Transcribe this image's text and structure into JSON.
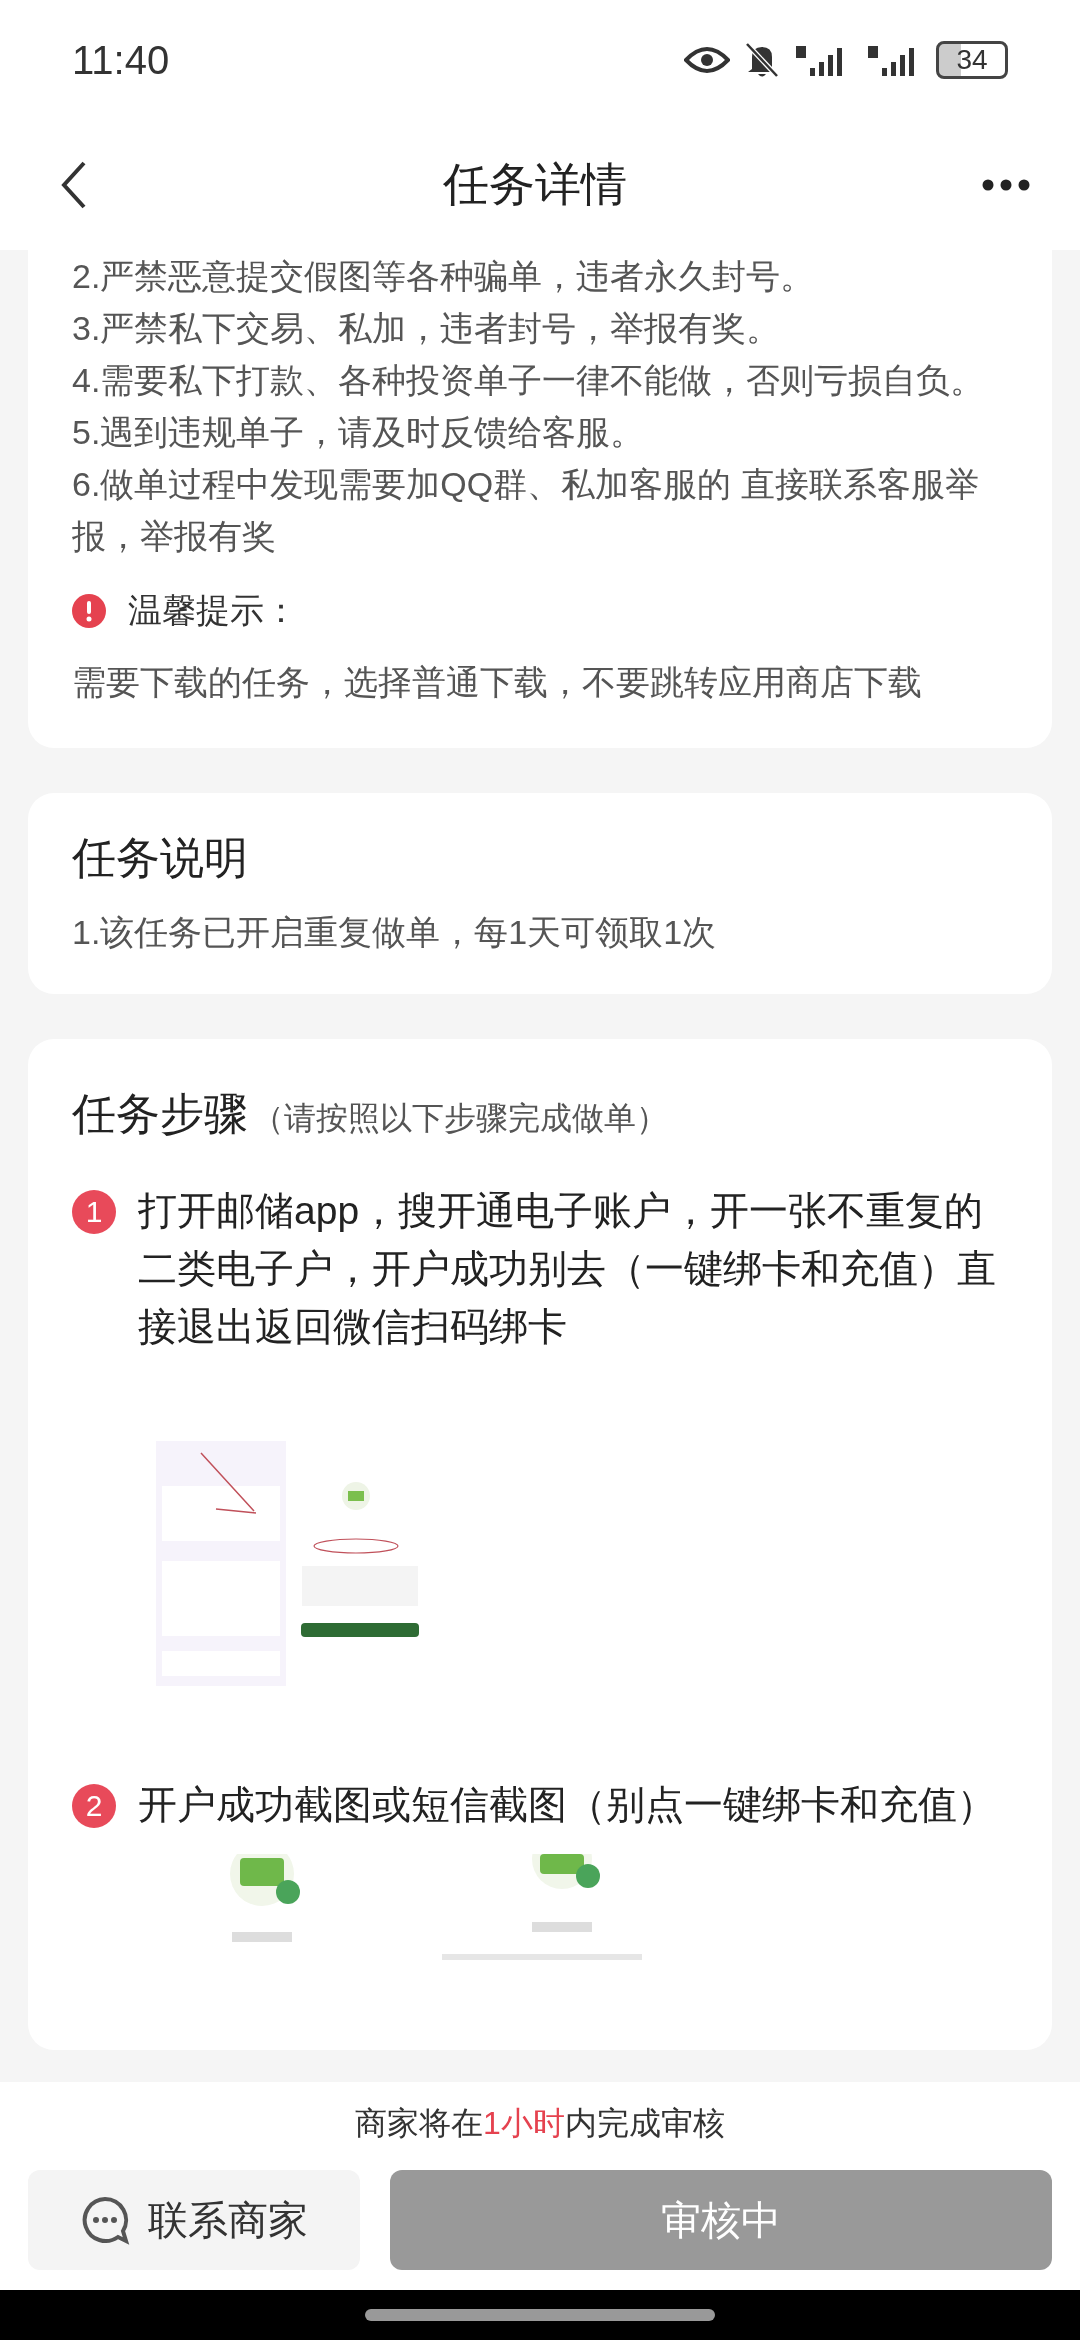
{
  "status_bar": {
    "time": "11:40",
    "battery": "34"
  },
  "header": {
    "title": "任务详情"
  },
  "rules": {
    "lines": [
      "2.严禁恶意提交假图等各种骗单，违者永久封号。",
      "3.严禁私下交易、私加，违者封号，举报有奖。",
      "4.需要私下打款、各种投资单子一律不能做，否则亏损自负。",
      "5.遇到违规单子，请及时反馈给客服。",
      "6.做单过程中发现需要加QQ群、私加客服的 直接联系客服举报，举报有奖"
    ],
    "tip": {
      "label": "温馨提示：",
      "text": "需要下载的任务，选择普通下载，不要跳转应用商店下载"
    }
  },
  "description": {
    "title": "任务说明",
    "lines": [
      "1.该任务已开启重复做单，每1天可领取1次"
    ]
  },
  "steps": {
    "title": "任务步骤",
    "subtitle": "（请按照以下步骤完成做单）",
    "items": [
      {
        "number": "1",
        "text": "打开邮储app，搜开通电子账户，开一张不重复的二类电子户，开户成功别去（一键绑卡和充值）直接退出返回微信扫码绑卡"
      },
      {
        "number": "2",
        "text": "开户成功截图或短信截图（别点一键绑卡和充值）"
      }
    ]
  },
  "footer": {
    "notice": {
      "before": "商家将在",
      "highlight": "1小时",
      "after": "内完成审核"
    },
    "contact_button": "联系商家",
    "status_button": {
      "label": "审核中",
      "disabled": true
    }
  }
}
